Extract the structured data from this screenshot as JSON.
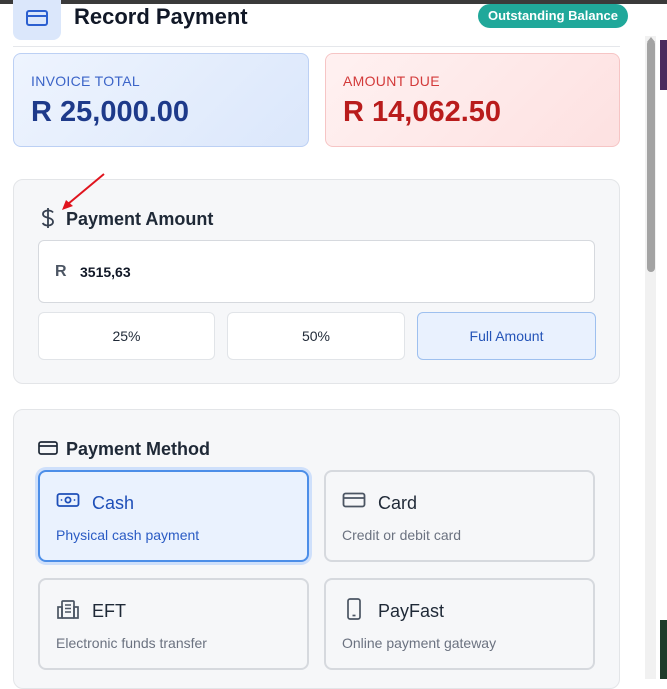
{
  "header": {
    "title": "Record Payment",
    "badge": "Outstanding Balance"
  },
  "summary": {
    "invoice_label": "INVOICE TOTAL",
    "invoice_value": "R 25,000.00",
    "due_label": "AMOUNT DUE",
    "due_value": "R 14,062.50"
  },
  "payment_amount": {
    "title": "Payment Amount",
    "currency": "R",
    "value": "3515,63",
    "buttons": [
      "25%",
      "50%",
      "Full Amount"
    ]
  },
  "payment_method": {
    "title": "Payment Method",
    "options": [
      {
        "name": "Cash",
        "description": "Physical cash payment",
        "selected": true,
        "icon": "banknote-icon"
      },
      {
        "name": "Card",
        "description": "Credit or debit card",
        "selected": false,
        "icon": "credit-card-icon"
      },
      {
        "name": "EFT",
        "description": "Electronic funds transfer",
        "selected": false,
        "icon": "building-icon"
      },
      {
        "name": "PayFast",
        "description": "Online payment gateway",
        "selected": false,
        "icon": "smartphone-icon"
      }
    ]
  },
  "colors": {
    "accent": "#20a89a",
    "invoice_blue": "#1e3a8a",
    "due_red": "#b91c1c",
    "selected_border": "#4c8ee8",
    "annotation_arrow": "#e0141e"
  }
}
